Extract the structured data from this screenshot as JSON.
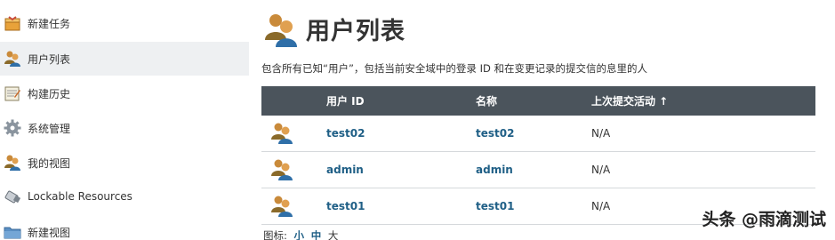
{
  "sidebar": {
    "items": [
      {
        "label": "新建任务",
        "icon": "new-task-icon"
      },
      {
        "label": "用户列表",
        "icon": "users-icon",
        "active": true
      },
      {
        "label": "构建历史",
        "icon": "notepad-icon"
      },
      {
        "label": "系统管理",
        "icon": "gear-icon"
      },
      {
        "label": "我的视图",
        "icon": "users-icon"
      },
      {
        "label": "Lockable Resources",
        "icon": "usb-icon"
      },
      {
        "label": "新建视图",
        "icon": "folder-icon"
      }
    ]
  },
  "main": {
    "title": "用户列表",
    "description": "包含所有已知“用户”，包括当前安全域中的登录 ID 和在变更记录的提交信的息里的人",
    "table": {
      "columns": [
        "",
        "用户 ID",
        "名称",
        "上次提交活动 ↑"
      ],
      "rows": [
        {
          "user_id": "test02",
          "name": "test02",
          "last_activity": "N/A"
        },
        {
          "user_id": "admin",
          "name": "admin",
          "last_activity": "N/A"
        },
        {
          "user_id": "test01",
          "name": "test01",
          "last_activity": "N/A"
        }
      ]
    },
    "icon_size": {
      "label": "图标:",
      "options": [
        "小",
        "中",
        "大"
      ]
    }
  },
  "watermark": "头条 @雨滴测试",
  "colors": {
    "header_bg": "#4b545c",
    "link": "#1f5f86",
    "active_bg": "#eef0f2"
  }
}
